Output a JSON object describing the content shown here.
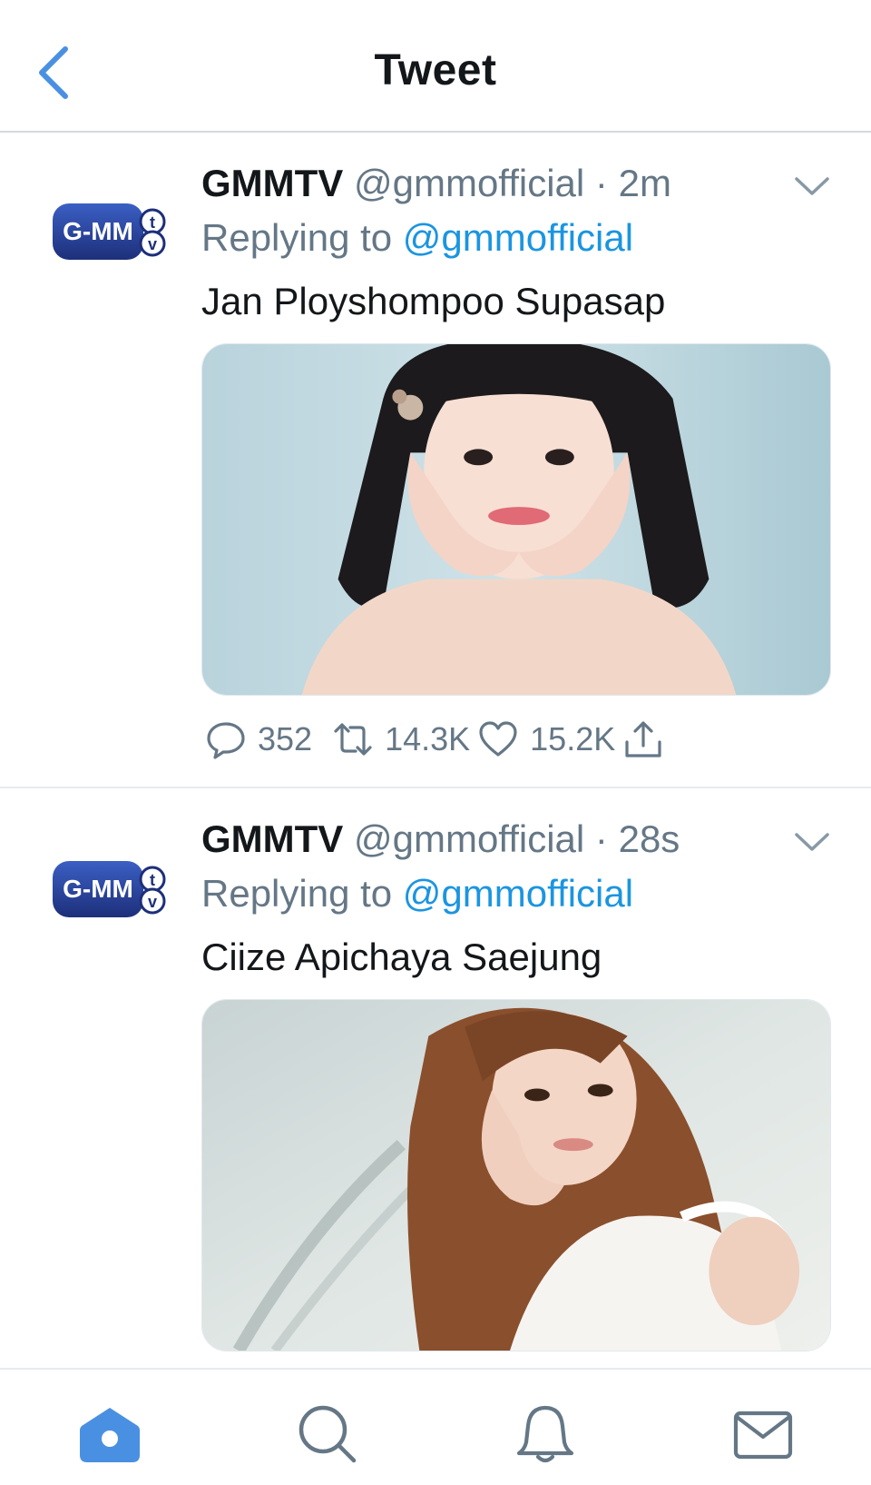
{
  "header": {
    "title": "Tweet"
  },
  "tweets": [
    {
      "name": "GMMTV",
      "handle": "@gmmofficial",
      "separator": "·",
      "time": "2m",
      "replying_prefix": "Replying to",
      "replying_to": "@gmmofficial",
      "text": "Jan Ployshompoo Supasap",
      "avatar_text": "G-MM",
      "avatar_badge": "tv",
      "stats": {
        "replies": "352",
        "retweets": "14.3K",
        "likes": "15.2K"
      }
    },
    {
      "name": "GMMTV",
      "handle": "@gmmofficial",
      "separator": "·",
      "time": "28s",
      "replying_prefix": "Replying to",
      "replying_to": "@gmmofficial",
      "text": "Ciize Apichaya Saejung",
      "avatar_text": "G-MM",
      "avatar_badge": "tv"
    }
  ],
  "tabbar": {
    "items": [
      "home-icon",
      "search-icon",
      "notifications-icon",
      "messages-icon"
    ],
    "active_color": "#4a90e2",
    "inactive_color": "#657786"
  },
  "colors": {
    "accent": "#1b95e0",
    "muted": "#657786",
    "text": "#14171a"
  }
}
